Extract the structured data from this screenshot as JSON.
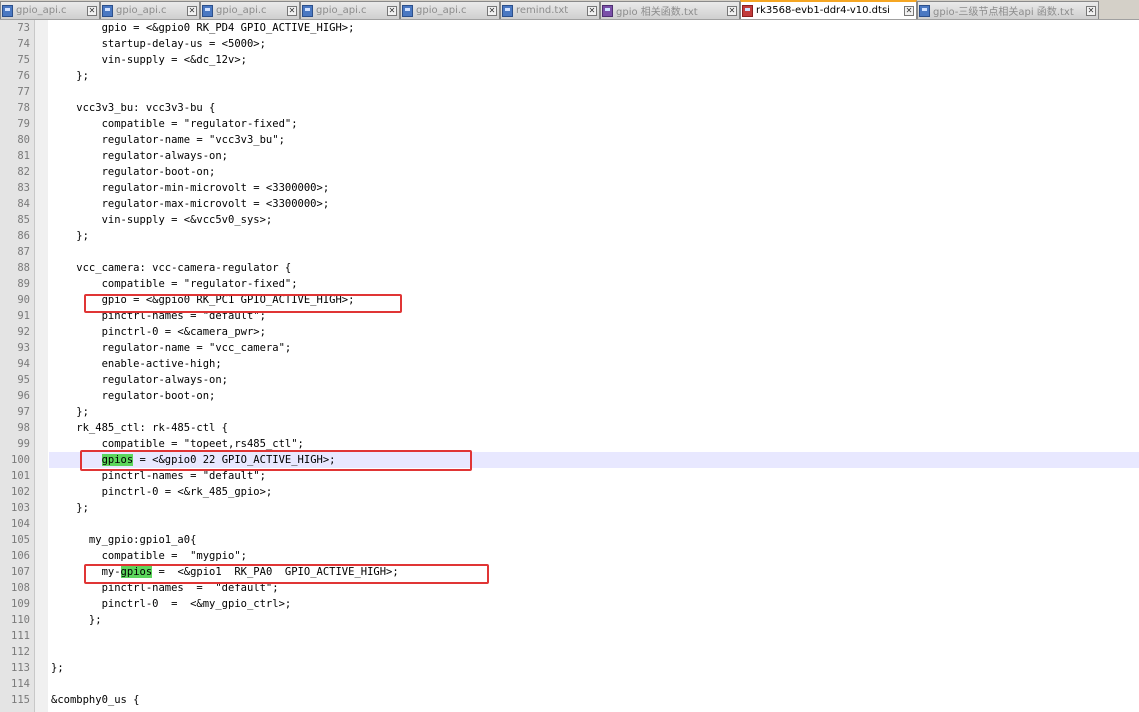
{
  "tabs": [
    {
      "label": "gpio_api.c",
      "active": false
    },
    {
      "label": "gpio_api.c",
      "active": false
    },
    {
      "label": "gpio_api.c",
      "active": false
    },
    {
      "label": "gpio_api.c",
      "active": false
    },
    {
      "label": "gpio_api.c",
      "active": false
    },
    {
      "label": "remind.txt",
      "active": false
    },
    {
      "label": "gpio 相关函数.txt",
      "active": false
    },
    {
      "label": "rk3568-evb1-ddr4-v10.dtsi",
      "active": true
    },
    {
      "label": "gpio-三级节点相关api 函数.txt",
      "active": false
    }
  ],
  "editor": {
    "current_line": 100,
    "lines": [
      {
        "n": "73",
        "t": "        gpio = <&gpio0 RK_PD4 GPIO_ACTIVE_HIGH>;"
      },
      {
        "n": "74",
        "t": "        startup-delay-us = <5000>;"
      },
      {
        "n": "75",
        "t": "        vin-supply = <&dc_12v>;"
      },
      {
        "n": "76",
        "t": "    };"
      },
      {
        "n": "77",
        "t": ""
      },
      {
        "n": "78",
        "t": "    vcc3v3_bu: vcc3v3-bu {"
      },
      {
        "n": "79",
        "t": "        compatible = \"regulator-fixed\";"
      },
      {
        "n": "80",
        "t": "        regulator-name = \"vcc3v3_bu\";"
      },
      {
        "n": "81",
        "t": "        regulator-always-on;"
      },
      {
        "n": "82",
        "t": "        regulator-boot-on;"
      },
      {
        "n": "83",
        "t": "        regulator-min-microvolt = <3300000>;"
      },
      {
        "n": "84",
        "t": "        regulator-max-microvolt = <3300000>;"
      },
      {
        "n": "85",
        "t": "        vin-supply = <&vcc5v0_sys>;"
      },
      {
        "n": "86",
        "t": "    };"
      },
      {
        "n": "87",
        "t": ""
      },
      {
        "n": "88",
        "t": "    vcc_camera: vcc-camera-regulator {"
      },
      {
        "n": "89",
        "t": "        compatible = \"regulator-fixed\";"
      },
      {
        "n": "90",
        "t": "        gpio = <&gpio0 RK_PC1 GPIO_ACTIVE_HIGH>;"
      },
      {
        "n": "91",
        "t": "        pinctrl-names = \"default\";"
      },
      {
        "n": "92",
        "t": "        pinctrl-0 = <&camera_pwr>;"
      },
      {
        "n": "93",
        "t": "        regulator-name = \"vcc_camera\";"
      },
      {
        "n": "94",
        "t": "        enable-active-high;"
      },
      {
        "n": "95",
        "t": "        regulator-always-on;"
      },
      {
        "n": "96",
        "t": "        regulator-boot-on;"
      },
      {
        "n": "97",
        "t": "    };"
      },
      {
        "n": "98",
        "t": "    rk_485_ctl: rk-485-ctl {"
      },
      {
        "n": "99",
        "t": "        compatible = \"topeet,rs485_ctl\";"
      },
      {
        "n": "100",
        "pre": "        ",
        "hl": "gpios",
        "post": " = <&gpio0 22 GPIO_ACTIVE_HIGH>;"
      },
      {
        "n": "101",
        "t": "        pinctrl-names = \"default\";"
      },
      {
        "n": "102",
        "t": "        pinctrl-0 = <&rk_485_gpio>;"
      },
      {
        "n": "103",
        "t": "    };"
      },
      {
        "n": "104",
        "t": ""
      },
      {
        "n": "105",
        "t": "      my_gpio:gpio1_a0{"
      },
      {
        "n": "106",
        "t": "        compatible =  \"mygpio\";"
      },
      {
        "n": "107",
        "pre": "        my-",
        "hl": "gpios",
        "post": " =  <&gpio1  RK_PA0  GPIO_ACTIVE_HIGH>;"
      },
      {
        "n": "108",
        "t": "        pinctrl-names  =  \"default\";"
      },
      {
        "n": "109",
        "t": "        pinctrl-0  =  <&my_gpio_ctrl>;"
      },
      {
        "n": "110",
        "t": "      };"
      },
      {
        "n": "111",
        "t": ""
      },
      {
        "n": "112",
        "t": ""
      },
      {
        "n": "113",
        "t": "};"
      },
      {
        "n": "114",
        "t": ""
      },
      {
        "n": "115",
        "t": "&combphy0_us {"
      }
    ]
  },
  "colors": {
    "annotation": "#e03535",
    "highlight": "#5cd65c",
    "current_line": "#e8e8ff"
  }
}
